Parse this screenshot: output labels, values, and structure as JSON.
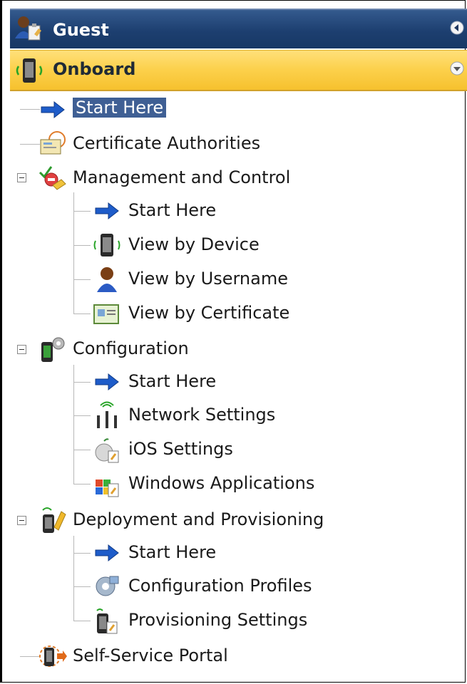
{
  "panels": {
    "guest": {
      "title": "Guest"
    },
    "onboard": {
      "title": "Onboard"
    }
  },
  "tree": {
    "start_here": "Start Here",
    "certificate_authorities": "Certificate Authorities",
    "management": {
      "label": "Management and Control",
      "children": [
        "Start Here",
        "View by Device",
        "View by Username",
        "View by Certificate"
      ]
    },
    "configuration": {
      "label": "Configuration",
      "children": [
        "Start Here",
        "Network Settings",
        "iOS Settings",
        "Windows Applications"
      ]
    },
    "deployment": {
      "label": "Deployment and Provisioning",
      "children": [
        "Start Here",
        "Configuration Profiles",
        "Provisioning Settings"
      ]
    },
    "self_service_portal": "Self-Service Portal"
  },
  "colors": {
    "guest_header": "#1d3f70",
    "onboard_header": "#fcd04a",
    "selection": "#3f5f94"
  }
}
